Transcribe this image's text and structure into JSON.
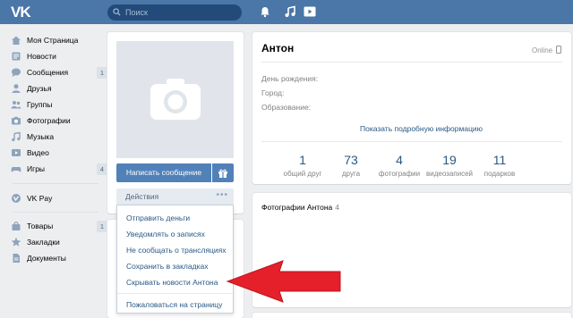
{
  "header": {
    "logo": "VK",
    "search_placeholder": "Поиск",
    "icons": [
      "bell-icon",
      "music-icon",
      "play-icon"
    ]
  },
  "sidebar": {
    "items": [
      {
        "label": "Моя Страница",
        "icon": "home-icon"
      },
      {
        "label": "Новости",
        "icon": "news-icon"
      },
      {
        "label": "Сообщения",
        "icon": "messages-icon",
        "count": "1"
      },
      {
        "label": "Друзья",
        "icon": "friends-icon"
      },
      {
        "label": "Группы",
        "icon": "groups-icon"
      },
      {
        "label": "Фотографии",
        "icon": "camera-icon"
      },
      {
        "label": "Музыка",
        "icon": "music-note-icon"
      },
      {
        "label": "Видео",
        "icon": "video-icon"
      },
      {
        "label": "Игры",
        "icon": "games-icon",
        "count": "4"
      }
    ],
    "vkpay": {
      "label": "VK Pay",
      "icon": "vkpay-icon"
    },
    "extra": [
      {
        "label": "Товары",
        "icon": "bag-icon",
        "count": "1"
      },
      {
        "label": "Закладки",
        "icon": "star-icon"
      },
      {
        "label": "Документы",
        "icon": "document-icon"
      }
    ]
  },
  "profile": {
    "write_message": "Написать сообщение",
    "actions_label": "Действия",
    "actions_menu": [
      "Отправить деньги",
      "Уведомлять о записях",
      "Не сообщать о трансляциях",
      "Сохранить в закладках",
      "Скрывать новости Антона",
      "Пожаловаться на страницу"
    ],
    "name": "Антон",
    "status": "Online",
    "info": [
      "День рождения:",
      "Город:",
      "Образование:"
    ],
    "more_info": "Показать подробную информацию",
    "stats": [
      {
        "num": "1",
        "label": "общий друг"
      },
      {
        "num": "73",
        "label": "друга"
      },
      {
        "num": "4",
        "label": "фотографии"
      },
      {
        "num": "19",
        "label": "видеозаписей"
      },
      {
        "num": "11",
        "label": "подарков"
      }
    ],
    "photos_title": "Фотографии Антона",
    "photos_count": "4"
  },
  "colors": {
    "header": "#4a76a8",
    "link": "#2a5885",
    "button": "#5181b8",
    "arrow": "#e5202a"
  }
}
